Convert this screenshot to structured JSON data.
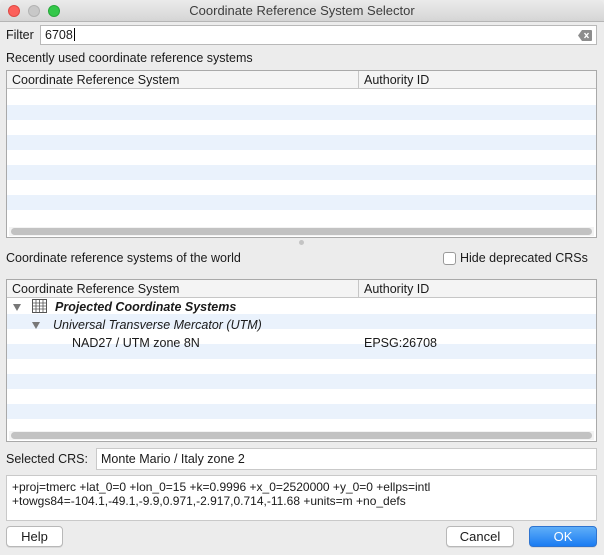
{
  "window": {
    "title": "Coordinate Reference System Selector"
  },
  "filter": {
    "label": "Filter",
    "value": "6708"
  },
  "recent": {
    "label": "Recently used coordinate reference systems",
    "columns": [
      "Coordinate Reference System",
      "Authority ID"
    ]
  },
  "world": {
    "label": "Coordinate reference systems of the world",
    "hide_deprecated": {
      "label": "Hide deprecated CRSs",
      "checked": false
    },
    "columns": [
      "Coordinate Reference System",
      "Authority ID"
    ],
    "tree": {
      "group": "Projected Coordinate Systems",
      "subgroup": "Universal Transverse Mercator (UTM)",
      "item": {
        "name": "NAD27 / UTM zone 8N",
        "authority": "EPSG:26708"
      }
    }
  },
  "selected": {
    "label": "Selected CRS:",
    "value": "Monte Mario / Italy zone 2"
  },
  "proj_string": {
    "line1": "+proj=tmerc +lat_0=0 +lon_0=15 +k=0.9996 +x_0=2520000 +y_0=0 +ellps=intl",
    "line2": "+towgs84=-104.1,-49.1,-9.9,0.971,-2.917,0.714,-11.68 +units=m +no_defs"
  },
  "buttons": {
    "help": "Help",
    "cancel": "Cancel",
    "ok": "OK"
  },
  "colors": {
    "accent": "#1b7cf2",
    "stripe": "#eaf2fc"
  }
}
